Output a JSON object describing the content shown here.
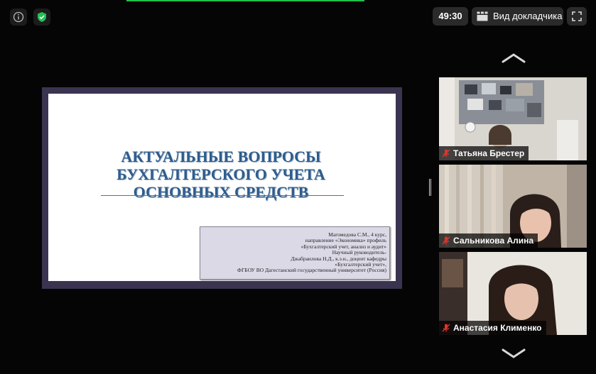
{
  "meeting": {
    "timer": "49:30",
    "view_label": "Вид докладчика"
  },
  "slide": {
    "title_lines": [
      "АКТУАЛЬНЫЕ ВОПРОСЫ",
      "БУХГАЛТЕРСКОГО УЧЕТА",
      "ОСНОВНЫХ СРЕДСТВ"
    ],
    "info_lines": [
      "Магомедова С.М., 4 курс,",
      "направление «Экономика» профиль",
      "«Бухгалтерский учет, анализ и аудит»",
      "Научный руководитель-",
      "Джабраилова Н.Д., к.э.н., доцент кафедры",
      "«Бухгалтерский учет»,",
      "ФГБОУ ВО Дагестанский государственный университет (Россия)"
    ]
  },
  "participants": [
    {
      "name": "Татьяна Брестер",
      "muted": true
    },
    {
      "name": "Сальникова Алина",
      "muted": true
    },
    {
      "name": "Анастасия Клименко",
      "muted": true
    }
  ],
  "colors": {
    "accent_green": "#1fbf4b",
    "muted_red": "#e0352b",
    "slide_title": "#2f5c8c"
  },
  "icons": [
    "info-icon",
    "shield-check-icon",
    "speaker-view-icon",
    "fullscreen-icon",
    "chevron-up-icon",
    "chevron-down-icon",
    "mic-muted-icon"
  ]
}
